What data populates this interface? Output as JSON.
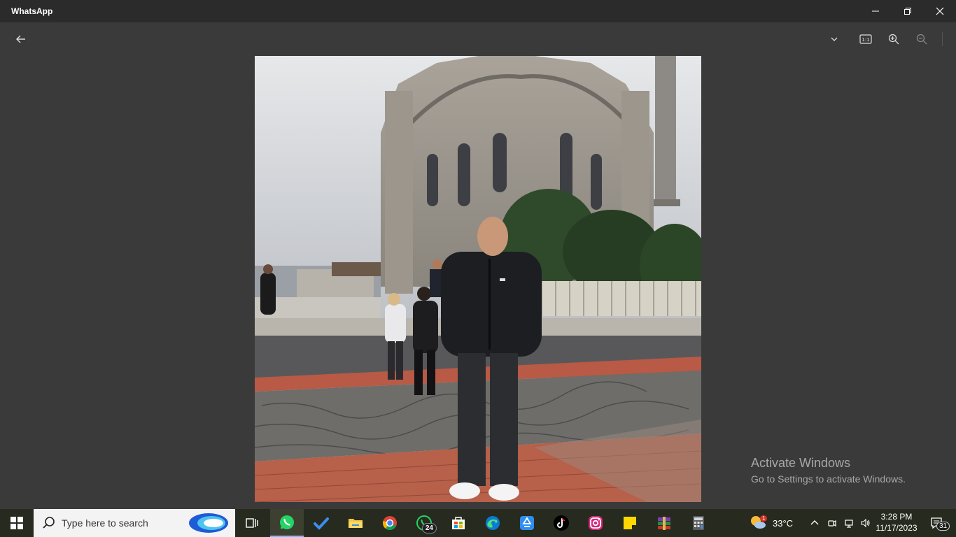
{
  "window": {
    "title": "WhatsApp",
    "controls": [
      "minimize-icon",
      "restore-icon",
      "close-icon"
    ]
  },
  "viewer": {
    "back_icon": "arrow-left-icon",
    "tools": [
      "chevron-down-icon",
      "actual-size-icon",
      "zoom-in-icon",
      "zoom-out-icon"
    ],
    "actual_size_label": "1:1",
    "photo": {
      "subject": "man standing in front of ornate mosque",
      "sky_color": "#cdd0d4",
      "pavement_color": "#b8624a"
    }
  },
  "watermark": {
    "line1": "Activate Windows",
    "line2": "Go to Settings to activate Windows."
  },
  "taskbar": {
    "search_placeholder": "Type here to search",
    "apps": [
      {
        "name": "task-view-icon",
        "active": false
      },
      {
        "name": "whatsapp-icon",
        "active": true
      },
      {
        "name": "todo-icon",
        "active": false
      },
      {
        "name": "file-explorer-icon",
        "active": false
      },
      {
        "name": "chrome-icon",
        "active": false
      },
      {
        "name": "whatsapp-beta-icon",
        "active": false,
        "badge": "24"
      },
      {
        "name": "microsoft-store-icon",
        "active": false
      },
      {
        "name": "edge-icon",
        "active": false
      },
      {
        "name": "recycle-app-icon",
        "active": false
      },
      {
        "name": "tiktok-icon",
        "active": false
      },
      {
        "name": "instagram-icon",
        "active": false
      },
      {
        "name": "sticky-notes-icon",
        "active": false
      },
      {
        "name": "winrar-icon",
        "active": false
      },
      {
        "name": "calculator-icon",
        "active": false
      }
    ],
    "weather": {
      "temp": "33°C",
      "badge": "1"
    },
    "clock": {
      "time": "3:28 PM",
      "date": "11/17/2023"
    },
    "notifications": "31",
    "colors": {
      "accent": "#8ab4f8",
      "taskbar_bg": "#272a1e"
    }
  }
}
